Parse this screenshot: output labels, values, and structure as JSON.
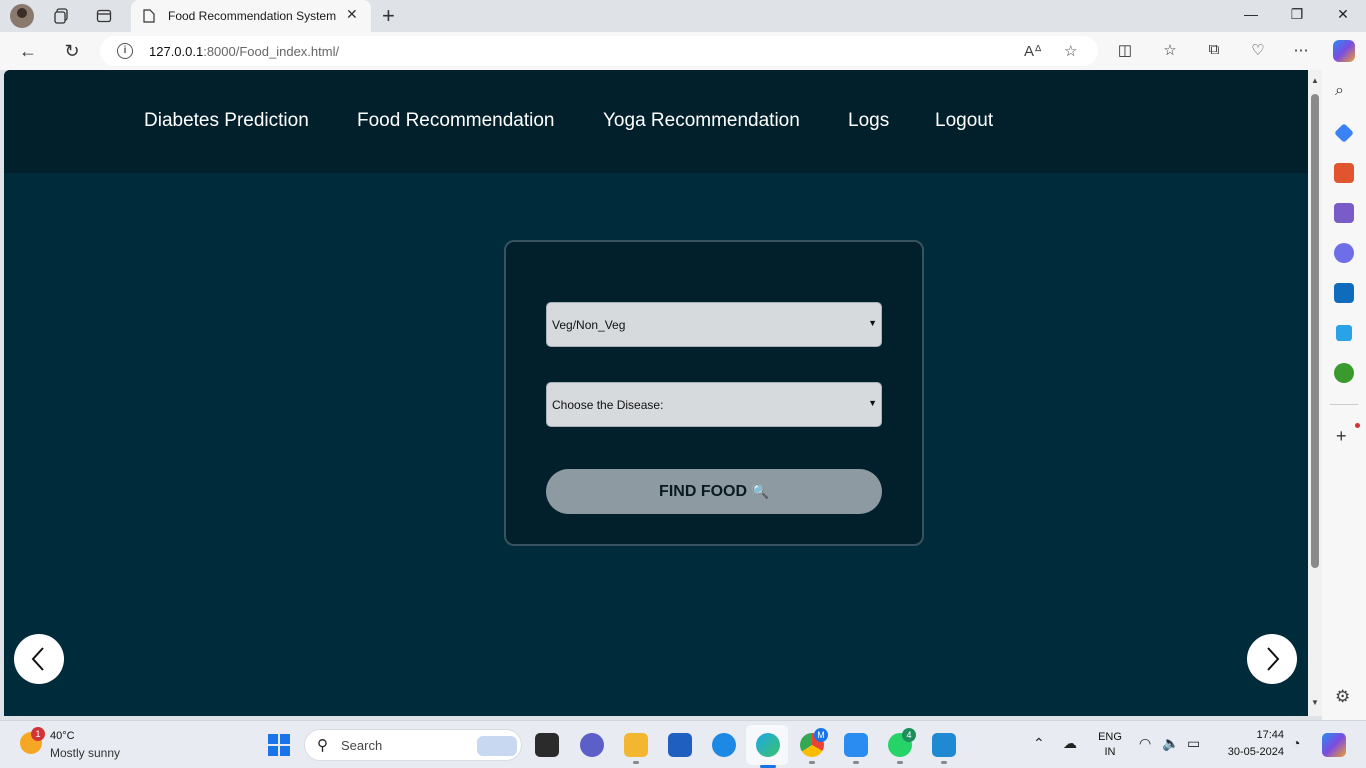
{
  "browser": {
    "tab_title": "Food Recommendation System",
    "url_host": "127.0.0.1",
    "url_path": ":8000/Food_index.html/"
  },
  "site": {
    "nav": [
      "Diabetes Prediction",
      "Food Recommendation",
      "Yoga Recommendation",
      "Logs",
      "Logout"
    ],
    "select_diet": "Veg/Non_Veg",
    "select_disease": "Choose the Disease:",
    "find_button": "FIND FOOD"
  },
  "taskbar": {
    "weather_badge": "1",
    "weather_temp": "40°C",
    "weather_desc": "Mostly sunny",
    "search_label": "Search",
    "lang_line1": "ENG",
    "lang_line2": "IN",
    "time": "17:44",
    "date": "30-05-2024",
    "chrome_badge": "M",
    "whatsapp_badge": "4"
  },
  "colors": {
    "page_bg": "#002b3a",
    "nav_bg": "#01202b",
    "button_bg": "#8d9aa1"
  }
}
